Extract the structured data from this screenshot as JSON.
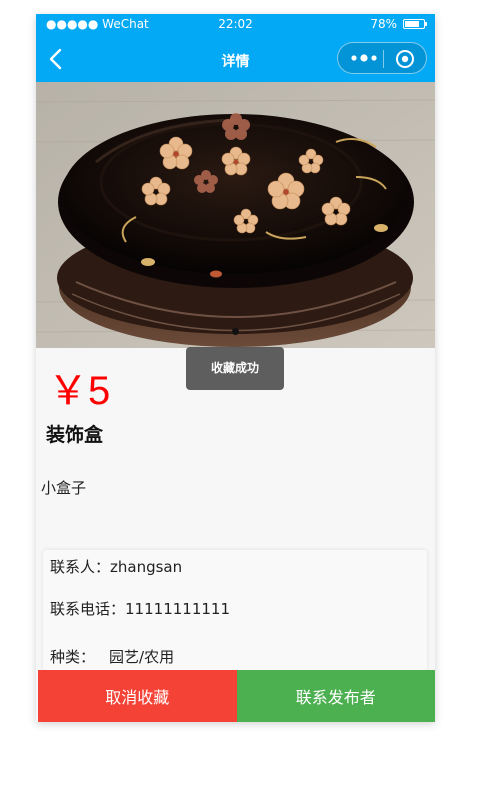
{
  "status_bar": {
    "carrier": "●●●●● WeChat",
    "time": "22:02",
    "battery": "78%",
    "battery_level": 0.78
  },
  "nav": {
    "title": "详情"
  },
  "banner": {
    "image": "lacquer-box-photo",
    "active_dot": 1,
    "dot_count": 1
  },
  "product": {
    "price": "￥5",
    "title": "装饰盒",
    "description": "小盒子"
  },
  "contact": {
    "person_label": "联系人：",
    "person": "zhangsan",
    "phone_label": "联系电话：",
    "phone": "11111111111",
    "category_label": "种类：",
    "category": "园艺/农用"
  },
  "toast": {
    "message": "收藏成功"
  },
  "actions": {
    "unfavorite": "取消收藏",
    "contact_publisher": "联系发布者"
  },
  "colors": {
    "nav_bg": "#03a9f4",
    "price": "#ff0000",
    "unfavorite_bg": "#f44336",
    "contact_bg": "#4caf50"
  }
}
